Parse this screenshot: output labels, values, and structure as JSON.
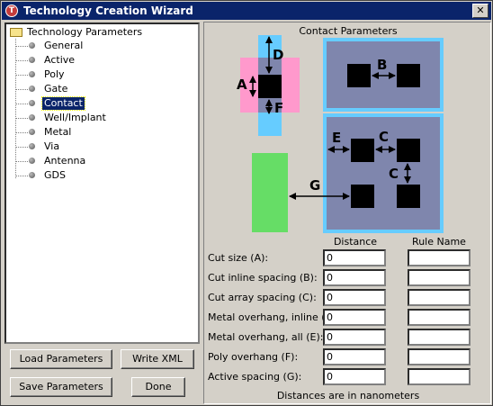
{
  "window": {
    "title": "Technology Creation Wizard",
    "close_glyph": "✕",
    "app_icon_glyph": "T"
  },
  "tree": {
    "root_label": "Technology Parameters",
    "items": [
      {
        "label": "General"
      },
      {
        "label": "Active"
      },
      {
        "label": "Poly"
      },
      {
        "label": "Gate"
      },
      {
        "label": "Contact",
        "selected": true
      },
      {
        "label": "Well/Implant"
      },
      {
        "label": "Metal"
      },
      {
        "label": "Via"
      },
      {
        "label": "Antenna"
      },
      {
        "label": "GDS"
      }
    ]
  },
  "buttons": {
    "load": "Load Parameters",
    "write": "Write XML",
    "save": "Save Parameters",
    "done": "Done"
  },
  "panel": {
    "title": "Contact Parameters",
    "diagram_labels": {
      "A": "A",
      "B": "B",
      "C": "C",
      "D": "D",
      "E": "E",
      "F": "F",
      "G": "G"
    },
    "col_distance": "Distance",
    "col_rule": "Rule Name",
    "rows": [
      {
        "label": "Cut size (A):",
        "distance": "0",
        "rule": ""
      },
      {
        "label": "Cut inline spacing (B):",
        "distance": "0",
        "rule": ""
      },
      {
        "label": "Cut array spacing (C):",
        "distance": "0",
        "rule": ""
      },
      {
        "label": "Metal overhang, inline (D):",
        "distance": "0",
        "rule": ""
      },
      {
        "label": "Metal overhang, all (E):",
        "distance": "0",
        "rule": ""
      },
      {
        "label": "Poly overhang (F):",
        "distance": "0",
        "rule": ""
      },
      {
        "label": "Active spacing (G):",
        "distance": "0",
        "rule": ""
      }
    ],
    "footer": "Distances are in nanometers"
  },
  "colors": {
    "titlebar": "#0a246a",
    "metal": "#66ccff",
    "poly": "#ff99cc",
    "active": "#66dd66",
    "well": "#7f86ad",
    "cut": "#000000"
  }
}
